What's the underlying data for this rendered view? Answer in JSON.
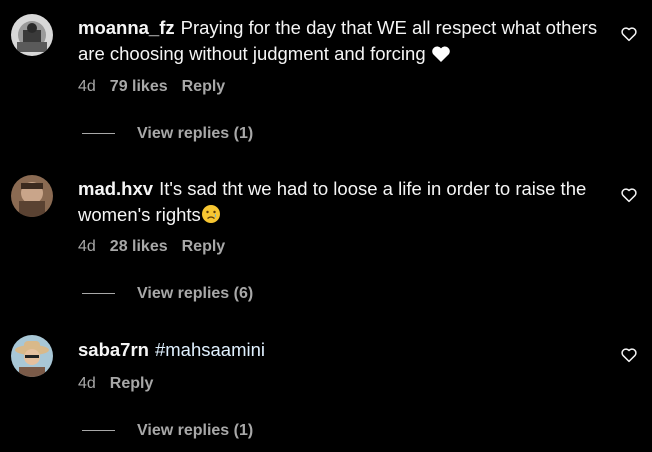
{
  "comments": [
    {
      "username": "moanna_fz",
      "text": "Praying for the day that WE all respect what others are choosing without judgment and forcing",
      "emoji": "white-heart-emoji",
      "time": "4d",
      "likes": "79 likes",
      "reply": "Reply",
      "view_replies": "View replies (1)"
    },
    {
      "username": "mad.hxv",
      "text": "It's sad tht we had to loose a life in order to raise the women's rights",
      "emoji": "crying-face-emoji",
      "time": "4d",
      "likes": "28 likes",
      "reply": "Reply",
      "view_replies": "View replies (6)"
    },
    {
      "username": "saba7rn",
      "hashtag": "#mahsaamini",
      "time": "4d",
      "reply": "Reply",
      "view_replies": "View replies (1)"
    }
  ],
  "colors": {
    "background": "#000000",
    "text": "#f5f5f5",
    "secondary": "#a8a8a8",
    "hashtag": "#e0f1ff"
  },
  "icons": [
    "heart-outline-icon",
    "white-heart-emoji",
    "crying-face-emoji"
  ]
}
